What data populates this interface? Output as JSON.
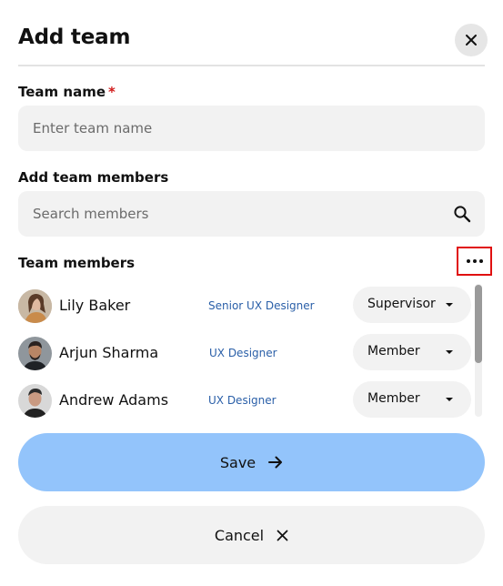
{
  "dialog": {
    "title": "Add team"
  },
  "team_name": {
    "label": "Team name",
    "required_mark": "*",
    "placeholder": "Enter team name",
    "value": ""
  },
  "add_members": {
    "label": "Add team members",
    "placeholder": "Search members",
    "value": ""
  },
  "members_section": {
    "label": "Team members",
    "members": [
      {
        "name": "Lily Baker",
        "title": "Senior UX Designer",
        "role": "Supervisor"
      },
      {
        "name": "Arjun Sharma",
        "title": "UX Designer",
        "role": "Member"
      },
      {
        "name": "Andrew Adams",
        "title": "UX Designer",
        "role": "Member"
      }
    ]
  },
  "actions": {
    "save_label": "Save",
    "cancel_label": "Cancel"
  },
  "colors": {
    "primary_button": "#93c4fb",
    "role_text": "#2a5fa8",
    "required": "#d11a1a",
    "highlight_border": "#e01010"
  }
}
